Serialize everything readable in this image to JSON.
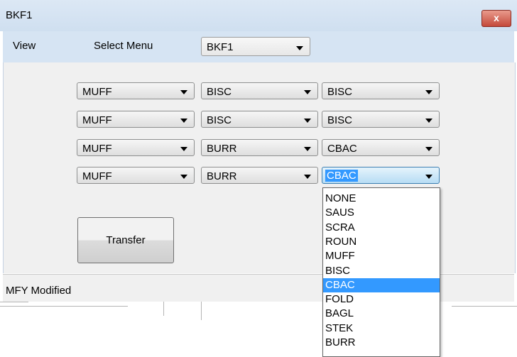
{
  "window": {
    "title": "BKF1",
    "close_symbol": "x"
  },
  "menubar": {
    "view_label": "View",
    "select_menu_label": "Select Menu",
    "select_menu_value": "BKF1"
  },
  "grid": {
    "rows": [
      [
        "MUFF",
        "BISC",
        "BISC"
      ],
      [
        "MUFF",
        "BISC",
        "BISC"
      ],
      [
        "MUFF",
        "BURR",
        "CBAC"
      ],
      [
        "MUFF",
        "BURR",
        "CBAC"
      ]
    ],
    "focused_cell": {
      "row": 3,
      "col": 2
    }
  },
  "transfer_label": "Transfer",
  "status": {
    "text": "MFY  Modified"
  },
  "dropdown": {
    "options": [
      "NONE",
      "SAUS",
      "SCRA",
      "ROUN",
      "MUFF",
      "BISC",
      "CBAC",
      "FOLD",
      "BAGL",
      "STEK",
      "BURR"
    ],
    "selected": "CBAC"
  }
}
